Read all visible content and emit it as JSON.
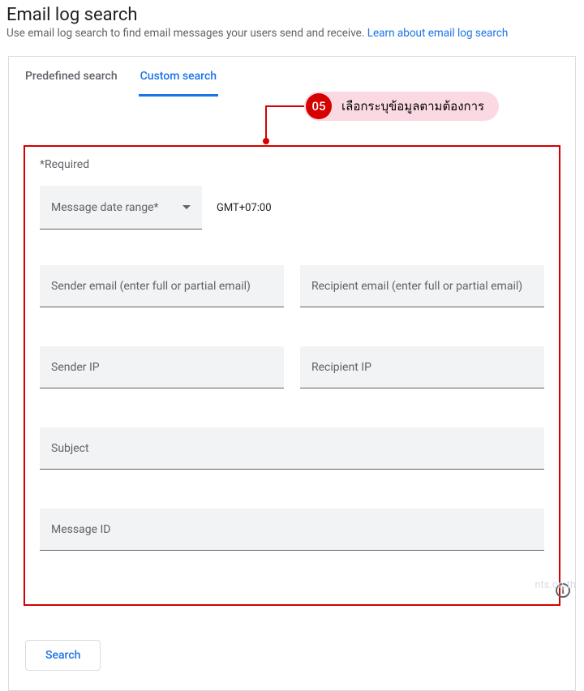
{
  "header": {
    "title": "Email log search",
    "subtitle_pre": "Use email log search to find email messages your users send and receive. ",
    "learn_link": "Learn about email log search"
  },
  "tabs": {
    "predefined": "Predefined search",
    "custom": "Custom search"
  },
  "callout": {
    "number": "05",
    "text": "เลือกระบุข้อมูลตามต้องการ"
  },
  "form": {
    "required_label": "*Required",
    "date_select": "Message date range*",
    "timezone": "GMT+07:00",
    "sender_email": "Sender email (enter full or partial email)",
    "recipient_email": "Recipient email (enter full or partial email)",
    "sender_ip": "Sender IP",
    "recipient_ip": "Recipient IP",
    "subject": "Subject",
    "message_id": "Message ID"
  },
  "footer": {
    "search_button": "Search"
  },
  "watermark": "nts.co.th"
}
